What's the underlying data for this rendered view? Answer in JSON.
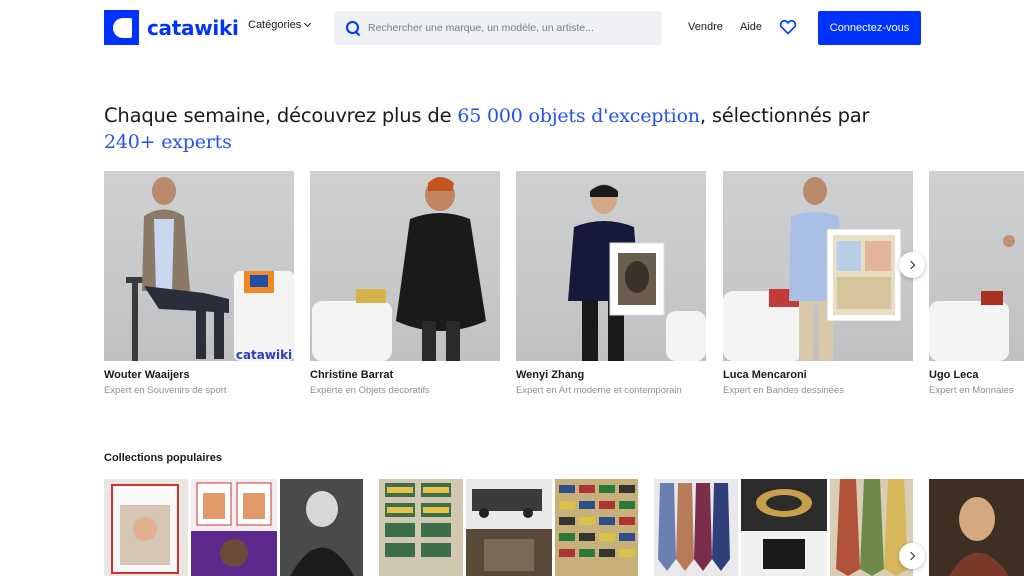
{
  "header": {
    "logo_text": "catawiki",
    "categories_label": "Catégories",
    "search_placeholder": "Rechercher une marque, un modèle, un artiste...",
    "sell_label": "Vendre",
    "help_label": "Aide",
    "login_label": "Connectez-vous"
  },
  "headline": {
    "part1": "Chaque semaine, découvrez plus de ",
    "accent1": "65 000 objets d'exception",
    "part2": ", sélectionnés par ",
    "accent2": "240+ experts"
  },
  "experts": [
    {
      "name": "Wouter Waaijers",
      "role": "Expert en Souvenirs de sport"
    },
    {
      "name": "Christine Barrat",
      "role": "Experte en Objets décoratifs"
    },
    {
      "name": "Wenyi Zhang",
      "role": "Expert en Art moderne et contemporain"
    },
    {
      "name": "Luca Mencaroni",
      "role": "Expert en Bandes dessinées"
    },
    {
      "name": "Ugo Leca",
      "role": "Expert en Monnaies"
    }
  ],
  "pedestal_brand": "catawiki",
  "collections": {
    "title": "Collections populaires"
  },
  "colors": {
    "brand_blue": "#0033ff",
    "accent_blue": "#2450f0",
    "muted_text": "#8a8f98"
  }
}
